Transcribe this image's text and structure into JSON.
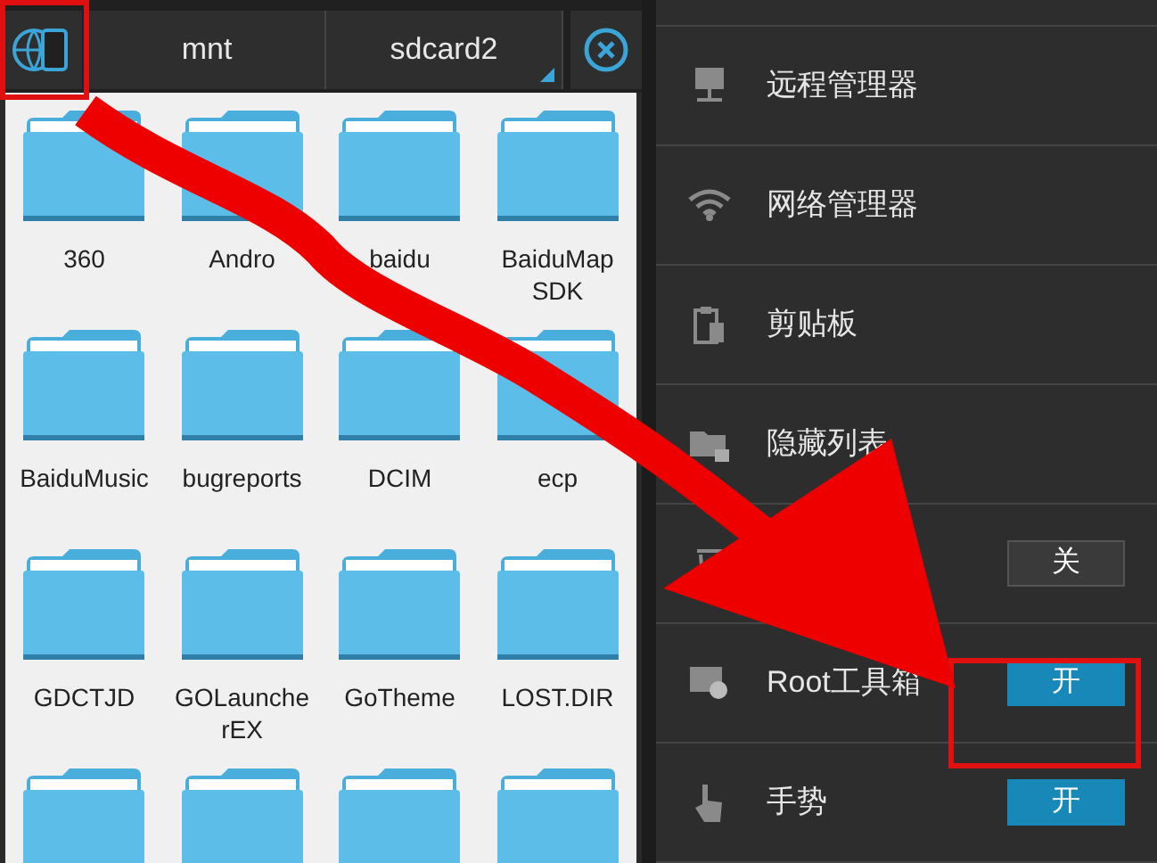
{
  "path_bar": {
    "segments": [
      "mnt",
      "sdcard2"
    ]
  },
  "folders": [
    {
      "name": "360"
    },
    {
      "name": "Andro"
    },
    {
      "name": "baidu"
    },
    {
      "name": "BaiduMap SDK"
    },
    {
      "name": "BaiduMusic"
    },
    {
      "name": "bugreports"
    },
    {
      "name": "DCIM"
    },
    {
      "name": "ecp"
    },
    {
      "name": "GDCTJD"
    },
    {
      "name": "GOLauncherEX"
    },
    {
      "name": "GoTheme"
    },
    {
      "name": "LOST.DIR"
    }
  ],
  "menu": [
    {
      "kind": "remote",
      "label": "远程管理器"
    },
    {
      "kind": "network",
      "label": "网络管理器"
    },
    {
      "kind": "clipboard",
      "label": "剪贴板"
    },
    {
      "kind": "hidden",
      "label": "隐藏列表"
    },
    {
      "kind": "trash",
      "toggle": {
        "label": "关",
        "on": false
      }
    },
    {
      "kind": "root",
      "label": "Root工具箱",
      "toggle": {
        "label": "开",
        "on": true
      }
    },
    {
      "kind": "gesture",
      "label": "手势",
      "toggle": {
        "label": "开",
        "on": true
      }
    }
  ]
}
